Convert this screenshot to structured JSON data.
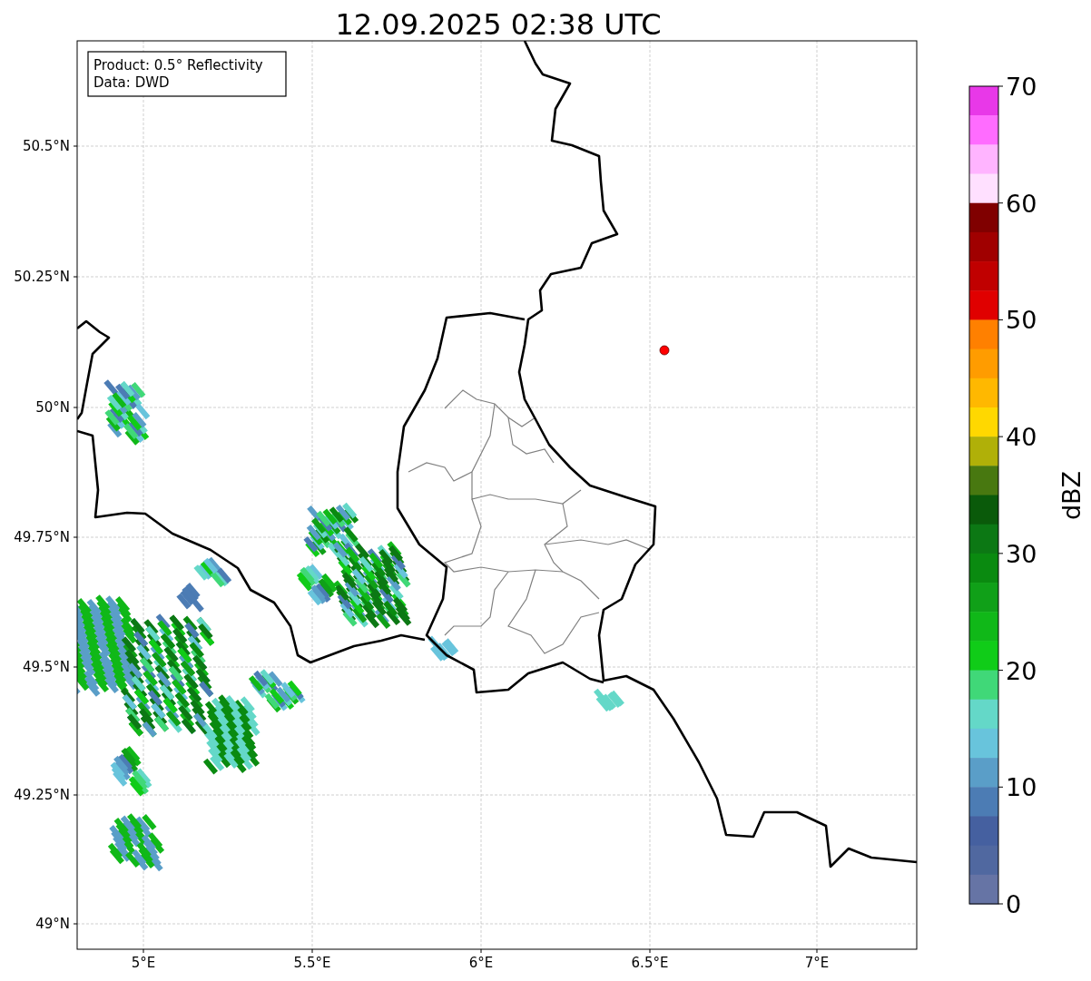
{
  "title": "12.09.2025 02:38 UTC",
  "annotation": [
    "Product: 0.5° Reflectivity",
    "Data: DWD"
  ],
  "x_axis": {
    "ticks": [
      "5°E",
      "5.5°E",
      "6°E",
      "6.5°E",
      "7°E"
    ]
  },
  "y_axis": {
    "ticks": [
      "50.5°N",
      "50.25°N",
      "50°N",
      "49.75°N",
      "49.5°N",
      "49.25°N",
      "49°N"
    ]
  },
  "colorbar": {
    "label": "dBZ",
    "ticks": [
      "70",
      "60",
      "50",
      "40",
      "30",
      "20",
      "10",
      "0"
    ],
    "bands": [
      {
        "color": "#e838e8"
      },
      {
        "color": "#ff6cff"
      },
      {
        "color": "#ffb4ff"
      },
      {
        "color": "#ffe0ff"
      },
      {
        "color": "#800000"
      },
      {
        "color": "#a00000"
      },
      {
        "color": "#c00000"
      },
      {
        "color": "#e00000"
      },
      {
        "color": "#ff8000"
      },
      {
        "color": "#ff9c00"
      },
      {
        "color": "#ffb800"
      },
      {
        "color": "#ffd800"
      },
      {
        "color": "#b0b008"
      },
      {
        "color": "#487810"
      },
      {
        "color": "#0a5a0a"
      },
      {
        "color": "#0c7814"
      },
      {
        "color": "#0a8a10"
      },
      {
        "color": "#10a018"
      },
      {
        "color": "#10b818"
      },
      {
        "color": "#10cc18"
      },
      {
        "color": "#40d878"
      },
      {
        "color": "#64d8c8"
      },
      {
        "color": "#68c4dc"
      },
      {
        "color": "#5a9ec8"
      },
      {
        "color": "#4c7cb4"
      },
      {
        "color": "#4560a0"
      },
      {
        "color": "#5068a0"
      },
      {
        "color": "#6674a5"
      }
    ]
  }
}
